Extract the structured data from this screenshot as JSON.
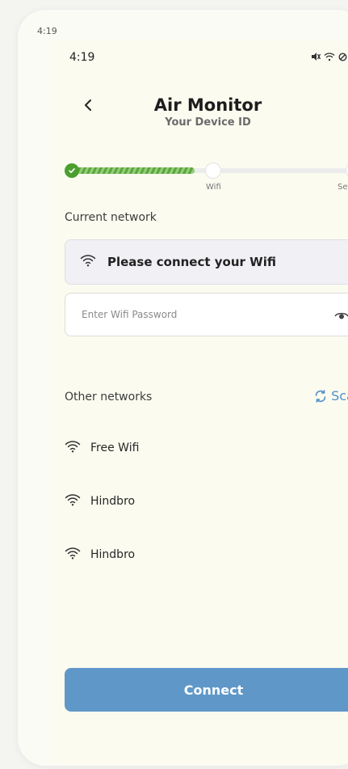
{
  "ghost": {
    "time": "4:19"
  },
  "status_bar": {
    "time": "4:19"
  },
  "header": {
    "title": "Air Monitor",
    "subtitle": "Your Device ID"
  },
  "stepper": {
    "steps": [
      "Wifi",
      "Setup"
    ],
    "progress": 0.43
  },
  "current_network": {
    "label": "Current network",
    "value": "Please connect your Wifi"
  },
  "password": {
    "placeholder": "Enter Wifi Password",
    "value": ""
  },
  "other_networks": {
    "label": "Other networks",
    "scan_label": "Scan",
    "items": [
      {
        "name": "Free Wifi"
      },
      {
        "name": "Hindbro"
      },
      {
        "name": "Hindbro"
      }
    ]
  },
  "connect_label": "Connect",
  "colors": {
    "accent": "#4f8fcb",
    "button": "#5f98c8",
    "progress": "#58a83a",
    "background": "#fbfbf0"
  },
  "icons": [
    "back-arrow-icon",
    "wifi-icon",
    "eye-icon",
    "refresh-icon",
    "chevron-right-icon",
    "mute-icon",
    "signal-icon",
    "battery-icon",
    "check-icon"
  ]
}
